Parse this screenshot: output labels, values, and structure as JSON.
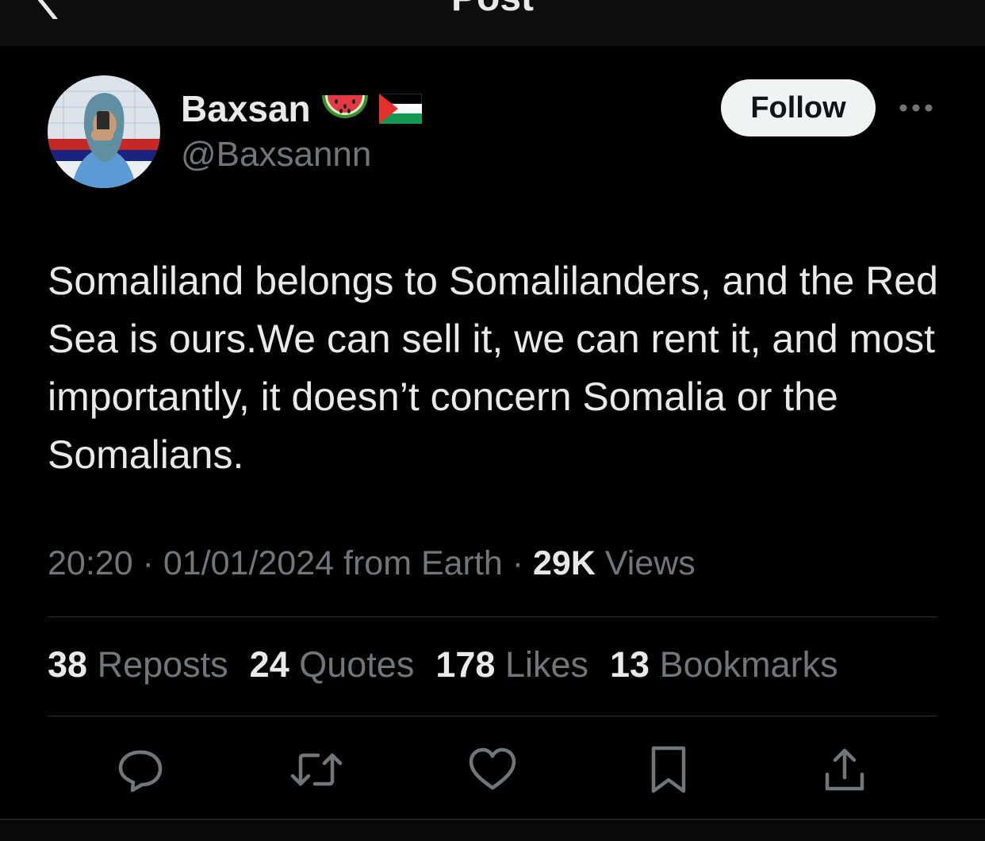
{
  "header": {
    "title": "Post"
  },
  "author": {
    "display_name": "Baxsan",
    "emojis": [
      "watermelon-emoji",
      "palestine-flag-emoji"
    ],
    "handle": "@Baxsannn"
  },
  "follow_label": "Follow",
  "post": {
    "text": "Somaliland belongs to Somalilanders, and the Red Sea is ours.We can sell it, we can rent it, and most importantly, it doesn’t concern Somalia or the Somalians."
  },
  "meta": {
    "time": "20:20",
    "date": "01/01/2024",
    "source": "from Earth",
    "views_count": "29K",
    "views_label": "Views"
  },
  "stats": [
    {
      "count": "38",
      "label": "Reposts"
    },
    {
      "count": "24",
      "label": "Quotes"
    },
    {
      "count": "178",
      "label": "Likes"
    },
    {
      "count": "13",
      "label": "Bookmarks"
    }
  ],
  "actions": [
    "reply-icon",
    "repost-icon",
    "like-icon",
    "bookmark-icon",
    "share-icon"
  ],
  "colors": {
    "background": "#000000",
    "text": "#e7e9ea",
    "secondary": "#71767b",
    "button": "#eff3f4"
  }
}
